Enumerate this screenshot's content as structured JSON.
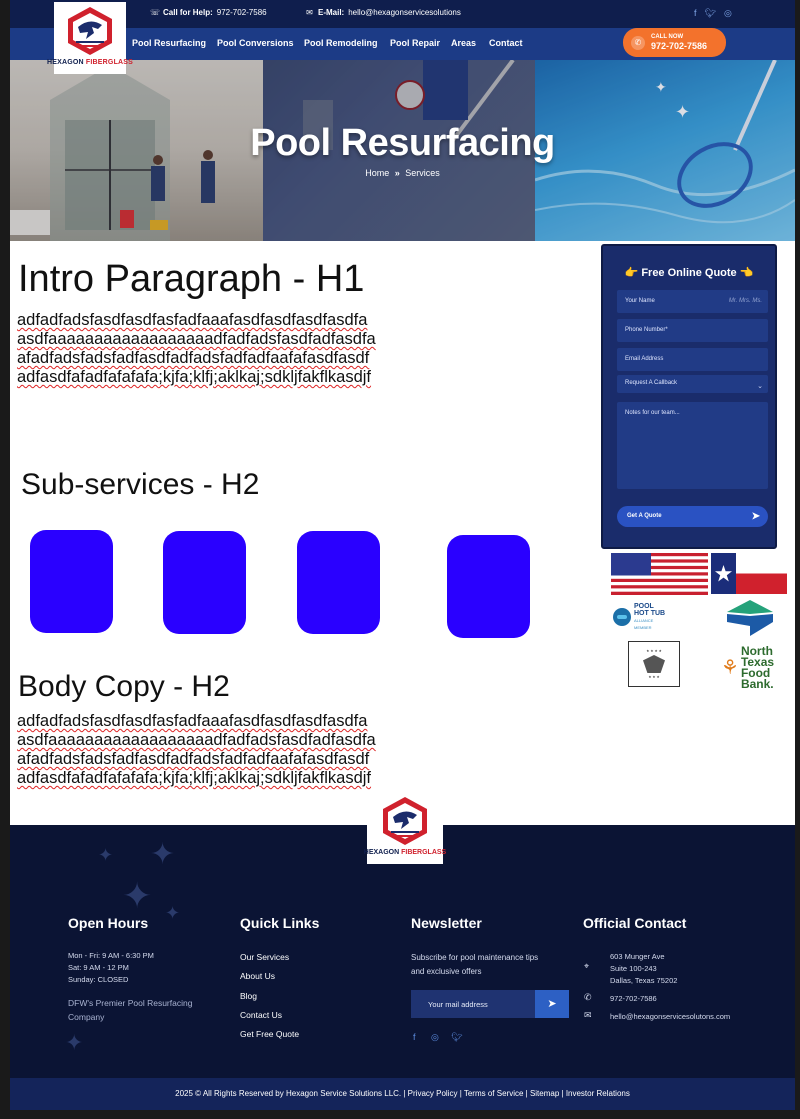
{
  "topbar": {
    "help_label": "Call for Help:",
    "help_phone": "972-702-7586",
    "email_label": "E-Mail:",
    "email": "hello@hexagonservicesolutions",
    "social": [
      "f",
      "t",
      "ig"
    ]
  },
  "logo": {
    "text_a": "HEXAGON ",
    "text_b": "FIBERGLASS"
  },
  "nav": {
    "items": [
      "Pool Resurfacing",
      "Pool Conversions",
      "Pool Remodeling",
      "Pool Repair",
      "Areas",
      "Contact"
    ]
  },
  "call_button": {
    "label": "CALL NOW",
    "phone": "972-702-7586",
    "color": "#f3722c"
  },
  "hero": {
    "title": "Pool Resurfacing",
    "crumb_home": "Home",
    "crumb_sep": "»",
    "crumb_current": "Services"
  },
  "main": {
    "h1": "Intro Paragraph - H1",
    "para1": [
      "adfadfadsfasdfasdfasfadfaaafasdfasdfasdfasdfa",
      "asdfaaaaaaaaaaaaaaaaaadfadfadsfasdfadfasdfa",
      "afadfadsfadsfadfasdfadfadsfadfadfaafafasdfasdf",
      "adfasdfafadfafafafa;kjfa;klfj;aklkaj;sdkljfakflkasdjf"
    ],
    "h2_sub": "Sub-services - H2",
    "h2_body": "Body Copy - H2",
    "para2": [
      "adfadfadsfasdfasdfasfadfaaafasdfasdfasdfasdfa",
      "asdfaaaaaaaaaaaaaaaaaadfadfadsfasdfadfasdfa",
      "afadfadsfadsfadfasdfadfadsfadfadfaafafasdfasdf",
      "adfasdfafadfafafafa;kjfa;klfj;aklkaj;sdkljfakflkasdjf"
    ],
    "square_color": "#2a00ff"
  },
  "quote": {
    "title": "👉 Free Online Quote 👈",
    "name_label": "Your Name",
    "name_placeholder": "Mr. Mrs. Ms.",
    "phone_label": "Phone Number*",
    "email_label": "Email Address",
    "select_value": "Request A Callback",
    "notes_label": "Notes for our team...",
    "button_label": "Get A Quote"
  },
  "badges": {
    "pool_a": "POOL",
    "pool_b": "HOT TUB",
    "pool_c": "ALLIANCE",
    "pool_d": "MEMBER",
    "food": [
      "North",
      "Texas",
      "Food",
      "Bank."
    ]
  },
  "footer": {
    "hours_title": "Open Hours",
    "hours": [
      "Mon - Fri: 9 AM - 6:30 PM",
      "Sat: 9 AM - 12 PM",
      "Sunday: CLOSED"
    ],
    "tagline": [
      "DFW's Premier Pool Resurfacing",
      "Company"
    ],
    "links_title": "Quick Links",
    "links": [
      "Our Services",
      "About Us",
      "Blog",
      "Contact Us",
      "Get Free Quote"
    ],
    "news_title": "Newsletter",
    "news_text": [
      "Subscribe for pool maintenance tips",
      "and exclusive offers"
    ],
    "news_placeholder": "Your mail address",
    "contact_title": "Official Contact",
    "address": [
      "603 Munger Ave",
      "Suite 100-243",
      "Dallas, Texas 75202"
    ],
    "phone": "972-702-7586",
    "email": "hello@hexagonservicesolutons.com",
    "copyright": "2025 © All Rights Reserved by Hexagon Service Solutions LLC. | Privacy Policy | Terms of Service | Sitemap | Investor Relations"
  }
}
